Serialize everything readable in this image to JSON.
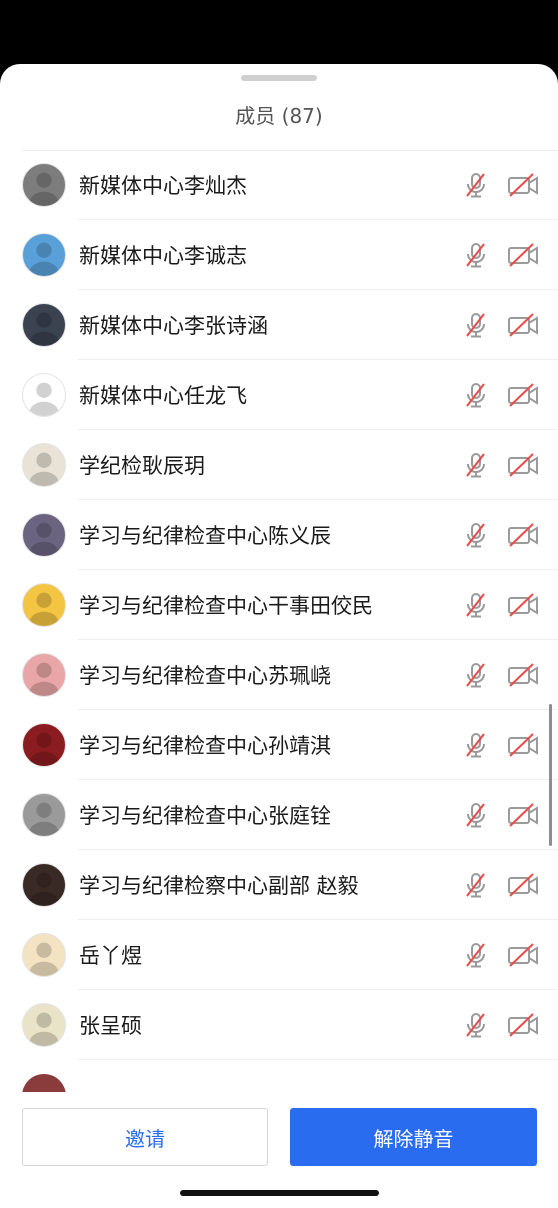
{
  "sheet": {
    "title": "成员 (87)"
  },
  "members": [
    {
      "name": "新媒体中心李灿杰",
      "avatar_color": "#7d7d7d",
      "mic": "muted",
      "camera": "off"
    },
    {
      "name": "新媒体中心李诚志",
      "avatar_color": "#5aa0d8",
      "mic": "muted",
      "camera": "off"
    },
    {
      "name": "新媒体中心李张诗涵",
      "avatar_color": "#3b4250",
      "mic": "muted",
      "camera": "off"
    },
    {
      "name": "新媒体中心任龙飞",
      "avatar_color": "#ffffff",
      "mic": "muted",
      "camera": "off"
    },
    {
      "name": "学纪检耿辰玥",
      "avatar_color": "#e8e3d6",
      "mic": "muted",
      "camera": "off"
    },
    {
      "name": "学习与纪律检查中心陈义辰",
      "avatar_color": "#6b6480",
      "mic": "muted",
      "camera": "off"
    },
    {
      "name": "学习与纪律检查中心干事田佼民",
      "avatar_color": "#f4c542",
      "mic": "muted",
      "camera": "off"
    },
    {
      "name": "学习与纪律检查中心苏珮峣",
      "avatar_color": "#e8a6a8",
      "mic": "muted",
      "camera": "off"
    },
    {
      "name": "学习与纪律检查中心孙靖淇",
      "avatar_color": "#8b1c20",
      "mic": "muted",
      "camera": "off"
    },
    {
      "name": "学习与纪律检查中心张庭铨",
      "avatar_color": "#9a9a9a",
      "mic": "muted",
      "camera": "off"
    },
    {
      "name": "学习与纪律检察中心副部 赵毅",
      "avatar_color": "#3a2a26",
      "mic": "muted",
      "camera": "off"
    },
    {
      "name": "岳丫煜",
      "avatar_color": "#f3e3c2",
      "mic": "muted",
      "camera": "off"
    },
    {
      "name": "张呈硕",
      "avatar_color": "#e9e3c8",
      "mic": "muted",
      "camera": "off"
    }
  ],
  "footer": {
    "invite_label": "邀请",
    "unmute_label": "解除静音"
  },
  "colors": {
    "accent": "#2a6cf0",
    "muted_slash": "#e84a4a",
    "icon_gray": "#9a9a9a"
  },
  "icons": {
    "mic": "mic-muted-icon",
    "camera": "camera-off-icon"
  }
}
